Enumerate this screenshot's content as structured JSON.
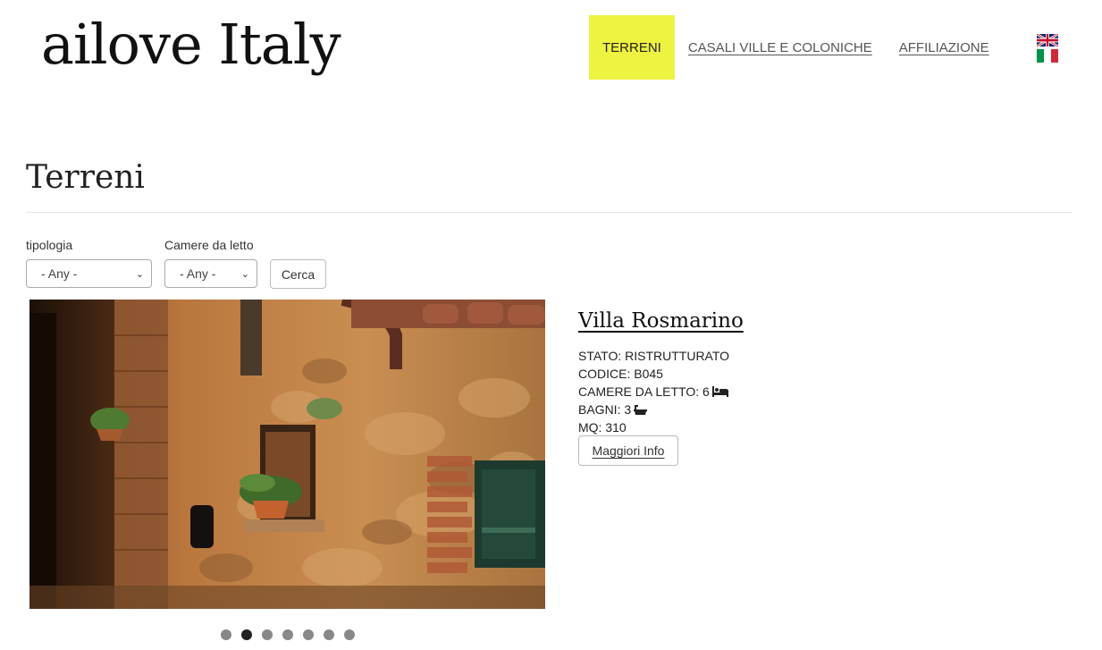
{
  "header": {
    "logo": "ailove Italy",
    "nav": [
      {
        "label": "TERRENI",
        "active": true
      },
      {
        "label": "CASALI VILLE E COLONICHE",
        "active": false
      },
      {
        "label": "AFFILIAZIONE",
        "active": false
      }
    ],
    "languages": [
      {
        "name": "english-flag-icon"
      },
      {
        "name": "italian-flag-icon"
      }
    ]
  },
  "page": {
    "title": "Terreni"
  },
  "filters": {
    "tipologia": {
      "label": "tipologia",
      "value": "- Any -"
    },
    "camere": {
      "label": "Camere da letto",
      "value": "- Any -"
    },
    "search_label": "Cerca"
  },
  "listing": {
    "title": "Villa Rosmarino",
    "stato": "STATO: RISTRUTTURATO",
    "codice": "CODICE: B045",
    "camere": "CAMERE DA LETTO: 6",
    "bagni": "BAGNI: 3",
    "mq": "MQ: 310",
    "more_label": "Maggiori Info",
    "icons": {
      "camere": "bed-icon",
      "bagni": "bathtub-icon"
    }
  },
  "carousel": {
    "total": 7,
    "active_index": 1
  },
  "colors": {
    "active_nav_bg": "#eef240"
  }
}
